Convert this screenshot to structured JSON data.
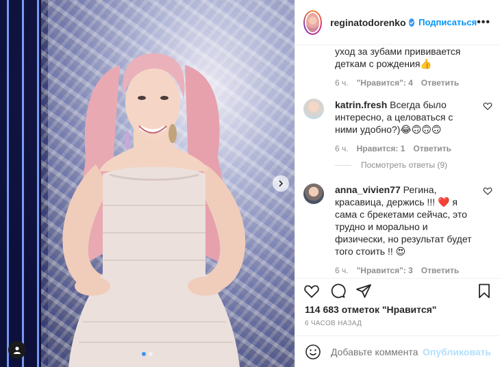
{
  "post": {
    "username": "reginatodorenko",
    "follow_label": "Подписаться",
    "menu_label": "•••"
  },
  "comments": [
    {
      "username": "",
      "text": "уход за зубами прививается деткам с рождения👍",
      "time": "6 ч.",
      "likes": "\"Нравится\": 4",
      "reply": "Ответить"
    },
    {
      "username": "katrin.fresh",
      "text": "Всегда было интересно, а целоваться с ними удобно?)😂🙃🙃🙃",
      "time": "6 ч.",
      "likes": "Нравится: 1",
      "reply": "Ответить",
      "view_replies": "Посмотреть ответы (9)"
    },
    {
      "username": "anna_vivien77",
      "text": "Регина, красавица, держись !!! ❤️ я сама с брекетами сейчас, это трудно и морально и физически, но результат будет того стоить !! 😍",
      "time": "6 ч.",
      "likes": "\"Нравится\": 3",
      "reply": "Ответить"
    }
  ],
  "likes_line": "114 683 отметок \"Нравится\"",
  "timestamp": "6 ЧАСОВ НАЗАД",
  "add_comment": {
    "placeholder": "Добавьте комментарий...",
    "post_label": "Опубликовать"
  },
  "carousel": {
    "count": 2,
    "active": 1
  },
  "colors": {
    "link_blue": "#0095f6",
    "verified": "#3897f0",
    "muted": "#8e8e8e"
  }
}
